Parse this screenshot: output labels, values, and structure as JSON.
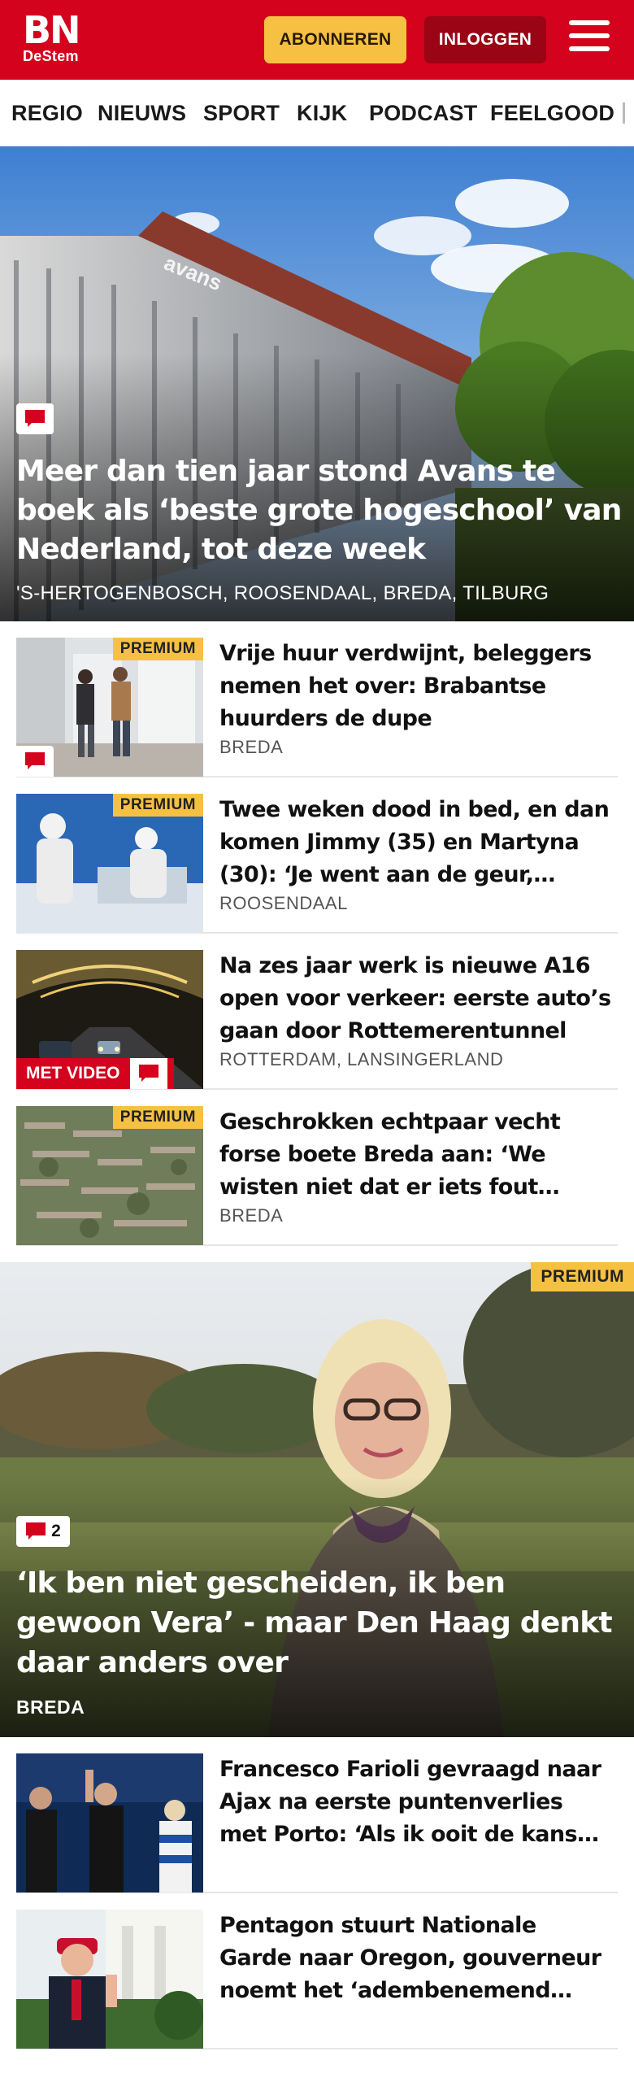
{
  "header": {
    "logo_main": "BN",
    "logo_sub": "DeStem",
    "subscribe_label": "ABONNEREN",
    "login_label": "INLOGGEN",
    "brand_color": "#d4021d",
    "accent_color": "#f6c143",
    "menu_icon": "hamburger-icon"
  },
  "nav": {
    "items": [
      "REGIO",
      "NIEUWS",
      "SPORT",
      "KIJK",
      "PODCAST",
      "FEELGOOD"
    ]
  },
  "hero": {
    "title": "Meer dan tien jaar stond Avans te boek als ‘beste grote hogeschool’ van Nederland, tot deze week",
    "location": "'S-HERTOGENBOSCH, ROOSENDAAL, BREDA, TILBURG",
    "building_text": "avans"
  },
  "articles": [
    {
      "badge": "PREMIUM",
      "title": "Vrije huur verdwijnt, beleggers nemen het over: Brabantse huurders de dupe",
      "location": "BREDA"
    },
    {
      "badge": "PREMIUM",
      "title": "Twee weken dood in bed, en dan komen Jimmy (35) en Martyna (30): ‘Je went aan de geur, maar...",
      "location": "ROOSENDAAL"
    },
    {
      "video_label": "MET VIDEO",
      "title": "Na zes jaar werk is nieuwe A16 open voor verkeer: eerste auto’s gaan door Rottemerentunnel",
      "location": "ROTTERDAM, LANSINGERLAND"
    },
    {
      "badge": "PREMIUM",
      "title": "Geschrokken echtpaar vecht forse boete Breda aan: ‘We wisten niet dat er iets fout ging...",
      "location": "BREDA"
    }
  ],
  "feature": {
    "badge": "PREMIUM",
    "comment_count": "2",
    "title": "‘Ik ben niet gescheiden, ik ben gewoon Vera’ - maar Den Haag denkt daar anders over",
    "location": "BREDA"
  },
  "more_articles": [
    {
      "title": "Francesco Farioli gevraagd naar Ajax na eerste puntenverlies met Porto: ‘Als ik ooit de kans krijg,..."
    },
    {
      "title": "Pentagon stuurt Nationale Garde naar Oregon, gouverneur noemt het ‘adembenemend machtsmi..."
    }
  ]
}
